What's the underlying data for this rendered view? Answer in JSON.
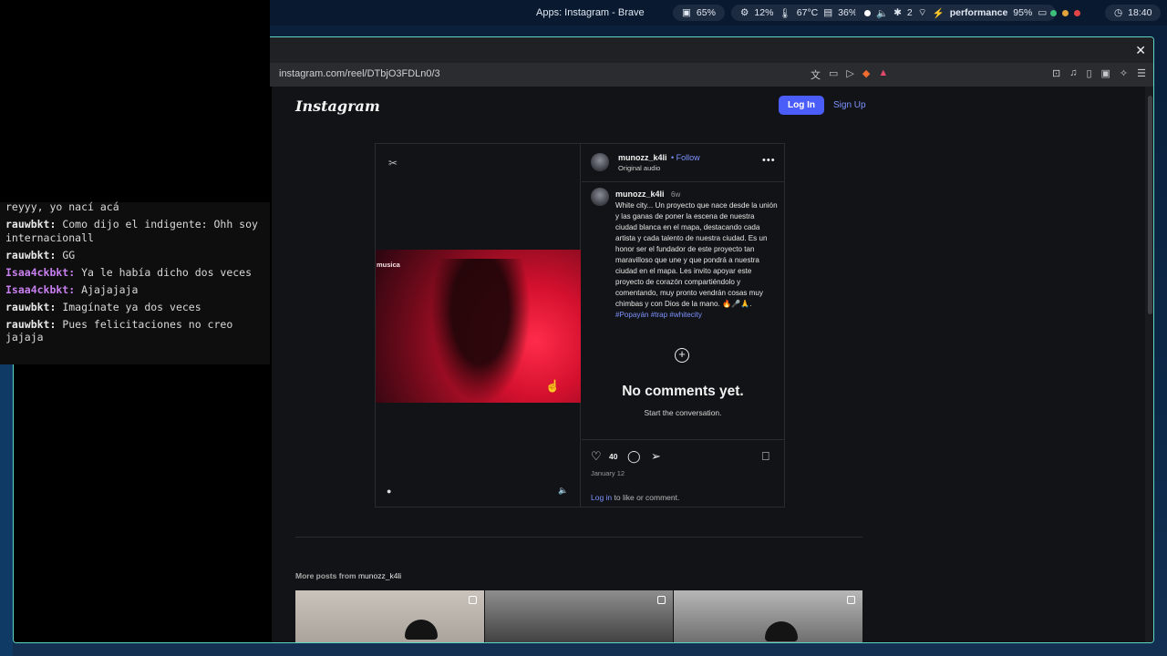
{
  "system_bar": {
    "window_title": "Apps: Instagram - Brave",
    "gpu": "65%",
    "cpu": "12%",
    "temp": "67°C",
    "memory": "36%",
    "bluetooth_count": "2",
    "power_profile": "performance",
    "battery": "95%",
    "clock": "18:40"
  },
  "chat": {
    "lines": [
      {
        "user": "",
        "text": "reyyy, yo nací acá"
      },
      {
        "user": "rauwbkt:",
        "text": " Como dijo el indigente: Ohh soy internacionall"
      },
      {
        "user": "rauwbkt:",
        "text": " GG"
      },
      {
        "user": "Isaa4ckbkt:",
        "text": " Ya le había dicho dos veces"
      },
      {
        "user": "Isaa4ckbkt:",
        "text": " Ajajajaja"
      },
      {
        "user": "rauwbkt:",
        "text": " Imagínate ya dos veces"
      },
      {
        "user": "rauwbkt:",
        "text": " Pues felicitaciones no creo jajaja"
      }
    ]
  },
  "browser": {
    "url": "instagram.com/reel/DTbjO3FDLn0/3"
  },
  "instagram": {
    "logo": "Instagram",
    "login_label": "Log In",
    "signup_label": "Sign Up",
    "post": {
      "username": "munozz_k4li",
      "follow_label": "• Follow",
      "audio": "Original audio",
      "video_overlay_text": "musica",
      "caption_user": "munozz_k4li",
      "caption_time": "6w",
      "caption_text": "White city... Un proyecto que nace desde la unión y las ganas de poner la escena de nuestra ciudad blanca en el mapa, destacando cada artista y cada talento de nuestra ciudad. Es un honor ser el fundador de este proyecto tan maravilloso que une y que pondrá a nuestra ciudad en el mapa. Les invito apoyar este proyecto de corazón compartiéndolo y comentando, muy pronto vendrán cosas muy chimbas y con Dios de la mano. 🔥🎤🙏. ",
      "caption_tags": "#Popayán #trap #whitecity",
      "no_comments": "No comments yet.",
      "start_conversation": "Start the conversation.",
      "likes": "40",
      "date": "January 12",
      "login_link": "Log in",
      "login_suffix": " to like or comment."
    },
    "more_posts_prefix": "More posts from ",
    "more_posts_user": "munozz_k4li"
  },
  "colors": {
    "accent_blue": "#4a5df9",
    "link_blue": "#7c93ff",
    "window_border": "#5fd6c4",
    "chat_user_alt": "#c87ff0"
  }
}
